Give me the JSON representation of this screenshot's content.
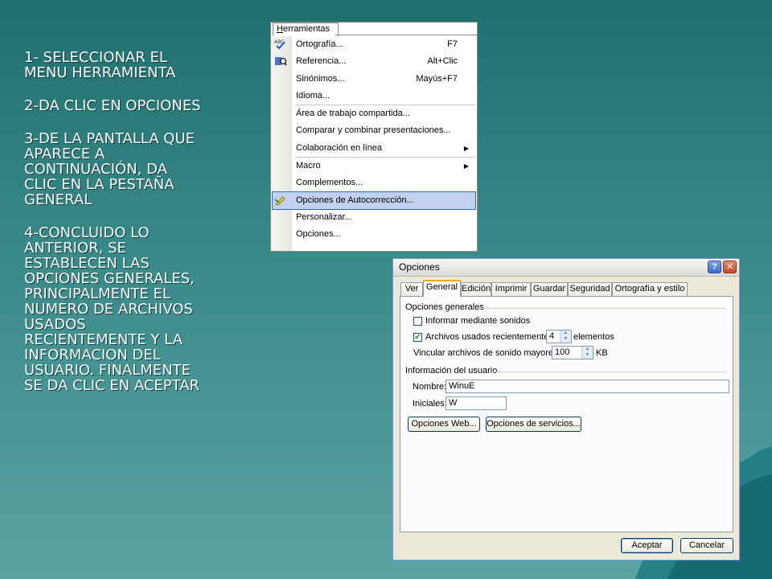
{
  "instructions": [
    "1- SELECCIONAR EL\nMENU HERRAMIENTA",
    "2-DA CLIC EN OPCIONES",
    "3-DE LA PANTALLA QUE\nAPARECE A\nCONTINUACIÓN, DA\nCLIC EN LA PESTAÑA\nGENERAL",
    "4-CONCLUIDO LO\nANTERIOR, SE\nESTABLECEN LAS\nOPCIONES GENERALES,\nPRINCIPALMENTE EL\nNUMERO DE ARCHIVOS\nUSADOS\nRECIENTEMENTE Y LA\nINFORMACION DEL\nUSUARIO. FINALMENTE\nSE DA CLIC EN ACEPTAR"
  ],
  "menu": {
    "title": "Herramientas",
    "items": [
      {
        "label": "Ortografía...",
        "shortcut": "F7",
        "icon": "spellcheck-icon"
      },
      {
        "label": "Referencia...",
        "shortcut": "Alt+Clic",
        "icon": "research-icon"
      },
      {
        "label": "Sinónimos...",
        "shortcut": "Mayús+F7"
      },
      {
        "label": "Idioma..."
      },
      {
        "label": "Área de trabajo compartida..."
      },
      {
        "label": "Comparar y combinar presentaciones..."
      },
      {
        "label": "Colaboración en línea",
        "submenu": true
      },
      {
        "label": "Macro",
        "submenu": true
      },
      {
        "label": "Complementos..."
      },
      {
        "label": "Opciones de Autocorrección...",
        "icon": "autocorrect-icon",
        "selected": true
      },
      {
        "label": "Personalizar..."
      },
      {
        "label": "Opciones..."
      }
    ],
    "submenu_glyph": "▶"
  },
  "dialog": {
    "title": "Opciones",
    "help": "?",
    "close": "✕",
    "tabs": [
      "Ver",
      "General",
      "Edición",
      "Imprimir",
      "Guardar",
      "Seguridad",
      "Ortografía y estilo"
    ],
    "active_tab": "General",
    "general_group": "Opciones generales",
    "inform_sounds": "Informar mediante sonidos",
    "inform_sounds_checked": false,
    "recent_files": "Archivos usados recientemente:",
    "recent_files_checked": true,
    "recent_files_value": "4",
    "recent_files_unit": "elementos",
    "link_sounds": "Vincular archivos de sonido mayores de",
    "link_sounds_value": "100",
    "link_sounds_unit": "KB",
    "user_group": "Información del usuario",
    "name_label": "Nombre:",
    "name_value": "WinuE",
    "initials_label": "Iniciales:",
    "initials_value": "W",
    "web_options": "Opciones Web...",
    "service_options": "Opciones de servicios...",
    "ok": "Aceptar",
    "cancel": "Cancelar"
  }
}
